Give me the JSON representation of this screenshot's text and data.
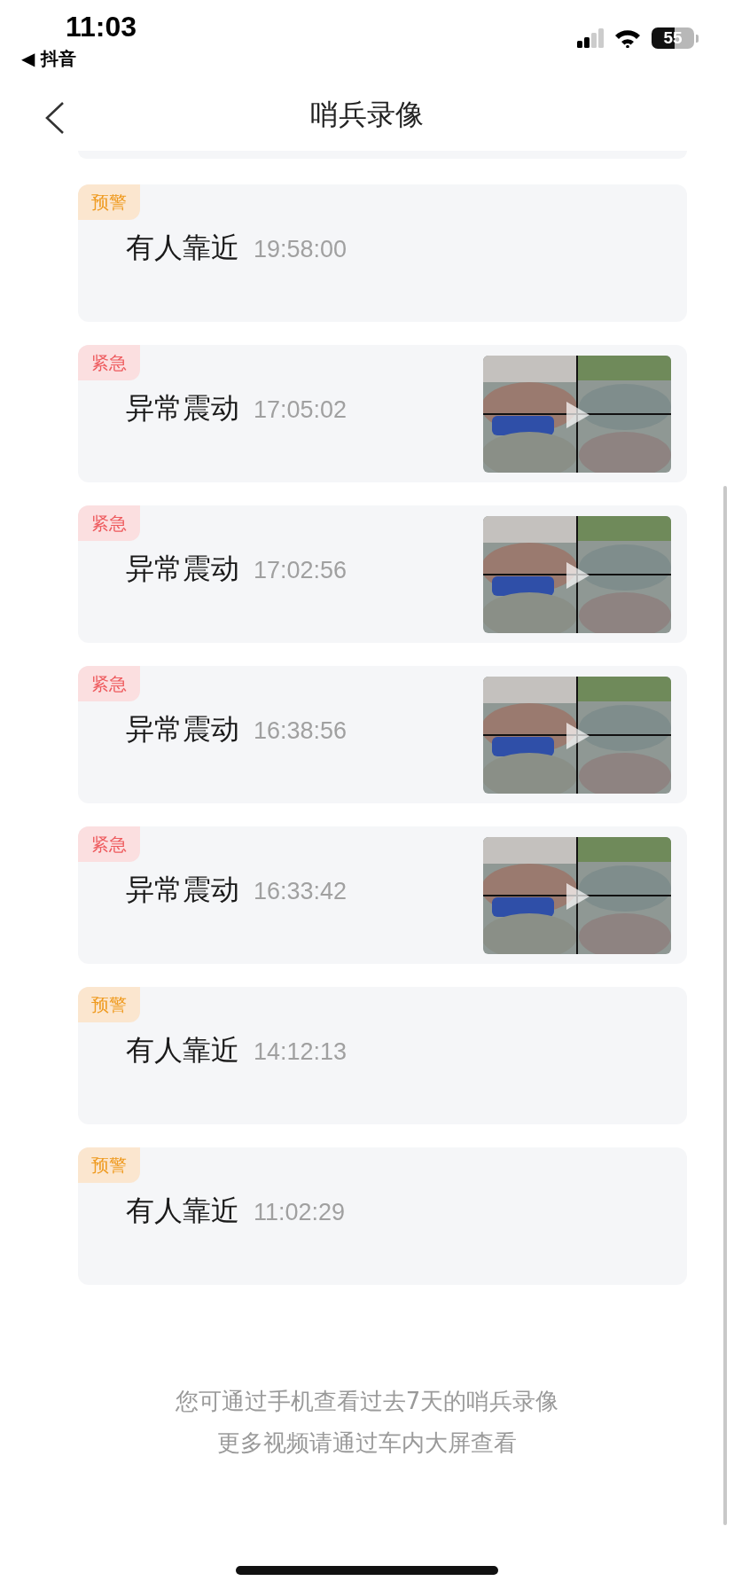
{
  "status_bar": {
    "time": "11:03",
    "back_app": "◀ 抖音",
    "battery": "55"
  },
  "nav": {
    "title": "哨兵录像"
  },
  "events": [
    {
      "kind": "warning",
      "badge": "预警",
      "title": "有人靠近",
      "time": "19:58:00",
      "has_video": false
    },
    {
      "kind": "urgent",
      "badge": "紧急",
      "title": "异常震动",
      "time": "17:05:02",
      "has_video": true
    },
    {
      "kind": "urgent",
      "badge": "紧急",
      "title": "异常震动",
      "time": "17:02:56",
      "has_video": true
    },
    {
      "kind": "urgent",
      "badge": "紧急",
      "title": "异常震动",
      "time": "16:38:56",
      "has_video": true
    },
    {
      "kind": "urgent",
      "badge": "紧急",
      "title": "异常震动",
      "time": "16:33:42",
      "has_video": true
    },
    {
      "kind": "warning",
      "badge": "预警",
      "title": "有人靠近",
      "time": "14:12:13",
      "has_video": false
    },
    {
      "kind": "warning",
      "badge": "预警",
      "title": "有人靠近",
      "time": "11:02:29",
      "has_video": false
    }
  ],
  "footer": [
    "您可通过手机查看过去7天的哨兵录像",
    "更多视频请通过车内大屏查看"
  ]
}
